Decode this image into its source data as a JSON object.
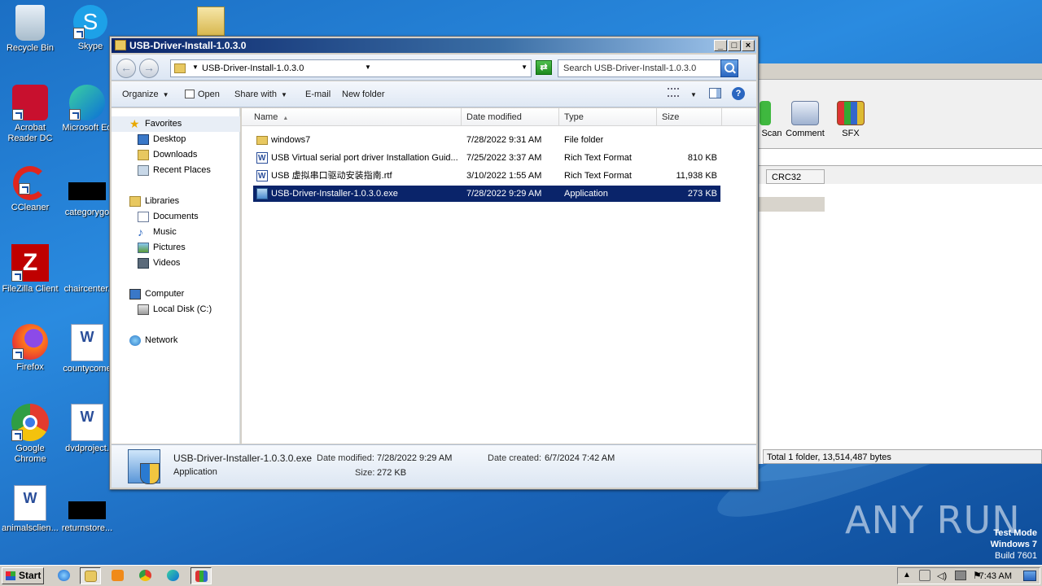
{
  "desktop": {
    "icons": [
      {
        "label": "Recycle Bin"
      },
      {
        "label": "Skype"
      },
      {
        "label": "Acrobat Reader DC"
      },
      {
        "label": "Microsoft Ed"
      },
      {
        "label": "CCleaner"
      },
      {
        "label": "categorygo"
      },
      {
        "label": "FileZilla Client"
      },
      {
        "label": "chaircenter."
      },
      {
        "label": "Firefox"
      },
      {
        "label": "countycome"
      },
      {
        "label": "Google Chrome"
      },
      {
        "label": "dvdproject."
      },
      {
        "label": "animalsclien..."
      },
      {
        "label": "returnstore..."
      }
    ],
    "watermark": {
      "line1": "Test Mode",
      "line2": "Windows 7",
      "line3": "Build 7601"
    },
    "anyrun": "ANY RUN"
  },
  "background_window": {
    "toolbar": [
      {
        "label": "Scan"
      },
      {
        "label": "Comment"
      },
      {
        "label": "SFX"
      }
    ],
    "column": "CRC32",
    "status": "Total 1 folder, 13,514,487 bytes"
  },
  "explorer": {
    "title": "USB-Driver-Install-1.0.3.0",
    "controls": {
      "minimize": "_",
      "maximize": "□",
      "close": "×"
    },
    "nav_back": "←",
    "nav_forward": "→",
    "address": "USB-Driver-Install-1.0.3.0",
    "search_placeholder": "Search USB-Driver-Install-1.0.3.0",
    "toolbar": {
      "organize": "Organize",
      "open": "Open",
      "share_with": "Share with",
      "email": "E-mail",
      "new_folder": "New folder",
      "help": "?"
    },
    "nav_pane": {
      "favorites": "Favorites",
      "desktop": "Desktop",
      "downloads": "Downloads",
      "recent_places": "Recent Places",
      "libraries": "Libraries",
      "documents": "Documents",
      "music": "Music",
      "pictures": "Pictures",
      "videos": "Videos",
      "computer": "Computer",
      "local_disk": "Local Disk (C:)",
      "network": "Network"
    },
    "columns": {
      "name": "Name",
      "date": "Date modified",
      "type": "Type",
      "size": "Size"
    },
    "files": [
      {
        "name": "windows7",
        "date": "7/28/2022 9:31 AM",
        "type": "File folder",
        "size": ""
      },
      {
        "name": "USB Virtual serial port driver Installation Guid...",
        "date": "7/25/2022 3:37 AM",
        "type": "Rich Text Format",
        "size": "810 KB"
      },
      {
        "name": "USB 虚拟串口驱动安装指南.rtf",
        "date": "3/10/2022 1:55 AM",
        "type": "Rich Text Format",
        "size": "11,938 KB"
      },
      {
        "name": "USB-Driver-Installer-1.0.3.0.exe",
        "date": "7/28/2022 9:29 AM",
        "type": "Application",
        "size": "273 KB"
      }
    ],
    "details": {
      "name": "USB-Driver-Installer-1.0.3.0.exe",
      "type": "Application",
      "date_modified_label": "Date modified:",
      "date_modified": "7/28/2022 9:29 AM",
      "size_label": "Size:",
      "size": "272 KB",
      "date_created_label": "Date created:",
      "date_created": "6/7/2024 7:42 AM"
    }
  },
  "taskbar": {
    "start": "Start",
    "clock": "7:43 AM"
  }
}
